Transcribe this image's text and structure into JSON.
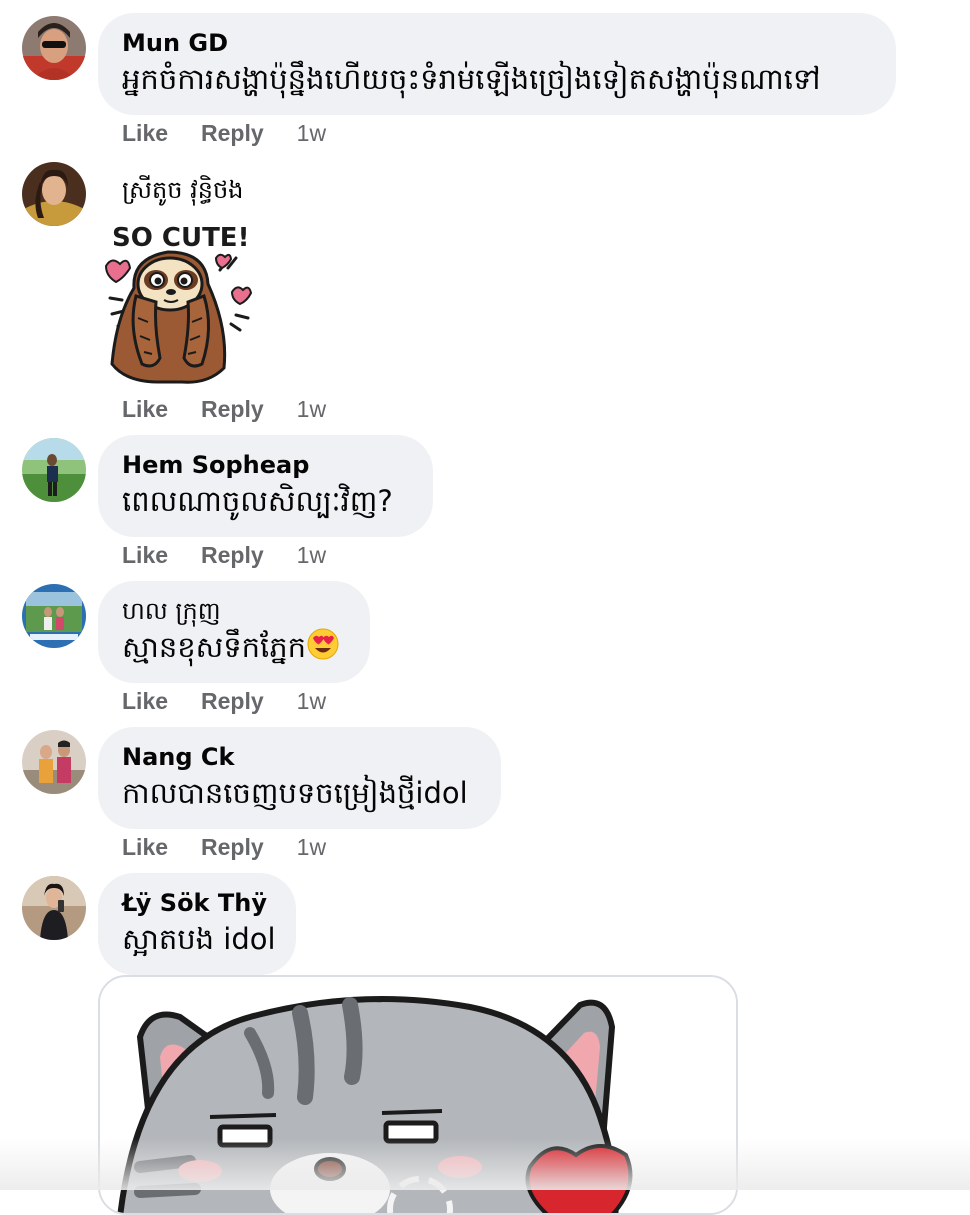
{
  "comments": [
    {
      "author": "Mun GD",
      "text": "អ្នកចំការសង្ហាប៉ុន្នឹងហើយចុះទំរាម់ឡើងច្រៀងទៀតសង្ហាប៉ុនណាទៅ",
      "avatar_icon": "profile-photo-avatar",
      "actions": {
        "like": "Like",
        "reply": "Reply",
        "time": "1w"
      }
    },
    {
      "author": "ស្រីតូច វុន្ធិថង",
      "sticker": {
        "caption": "SO CUTE!",
        "icon": "sloth-sticker-icon"
      },
      "avatar_icon": "profile-photo-avatar",
      "actions": {
        "like": "Like",
        "reply": "Reply",
        "time": "1w"
      }
    },
    {
      "author": "Hem Sopheap",
      "text": "ពេលណាចូលសិល្បៈវិញ?",
      "avatar_icon": "profile-photo-avatar",
      "actions": {
        "like": "Like",
        "reply": "Reply",
        "time": "1w"
      }
    },
    {
      "author": "ហល ក្រុញ",
      "text": "ស្មានខុសទឹកភ្នែក",
      "emoji": "heart-eyes-emoji-icon",
      "avatar_icon": "profile-photo-avatar",
      "actions": {
        "like": "Like",
        "reply": "Reply",
        "time": "1w"
      }
    },
    {
      "author": "Nang Ck",
      "text": "កាលបានចេញបទចម្រៀងថ្មីidol",
      "avatar_icon": "profile-photo-avatar",
      "actions": {
        "like": "Like",
        "reply": "Reply",
        "time": "1w"
      }
    },
    {
      "author": "Łÿ Sök Thÿ",
      "text": "ស្អាតបង idol",
      "avatar_icon": "profile-photo-avatar",
      "gif": {
        "icon": "cat-gif-sticker-icon"
      }
    }
  ],
  "colors": {
    "bubble": "#eff1f4",
    "meta": "#65676b",
    "text": "#050505"
  }
}
